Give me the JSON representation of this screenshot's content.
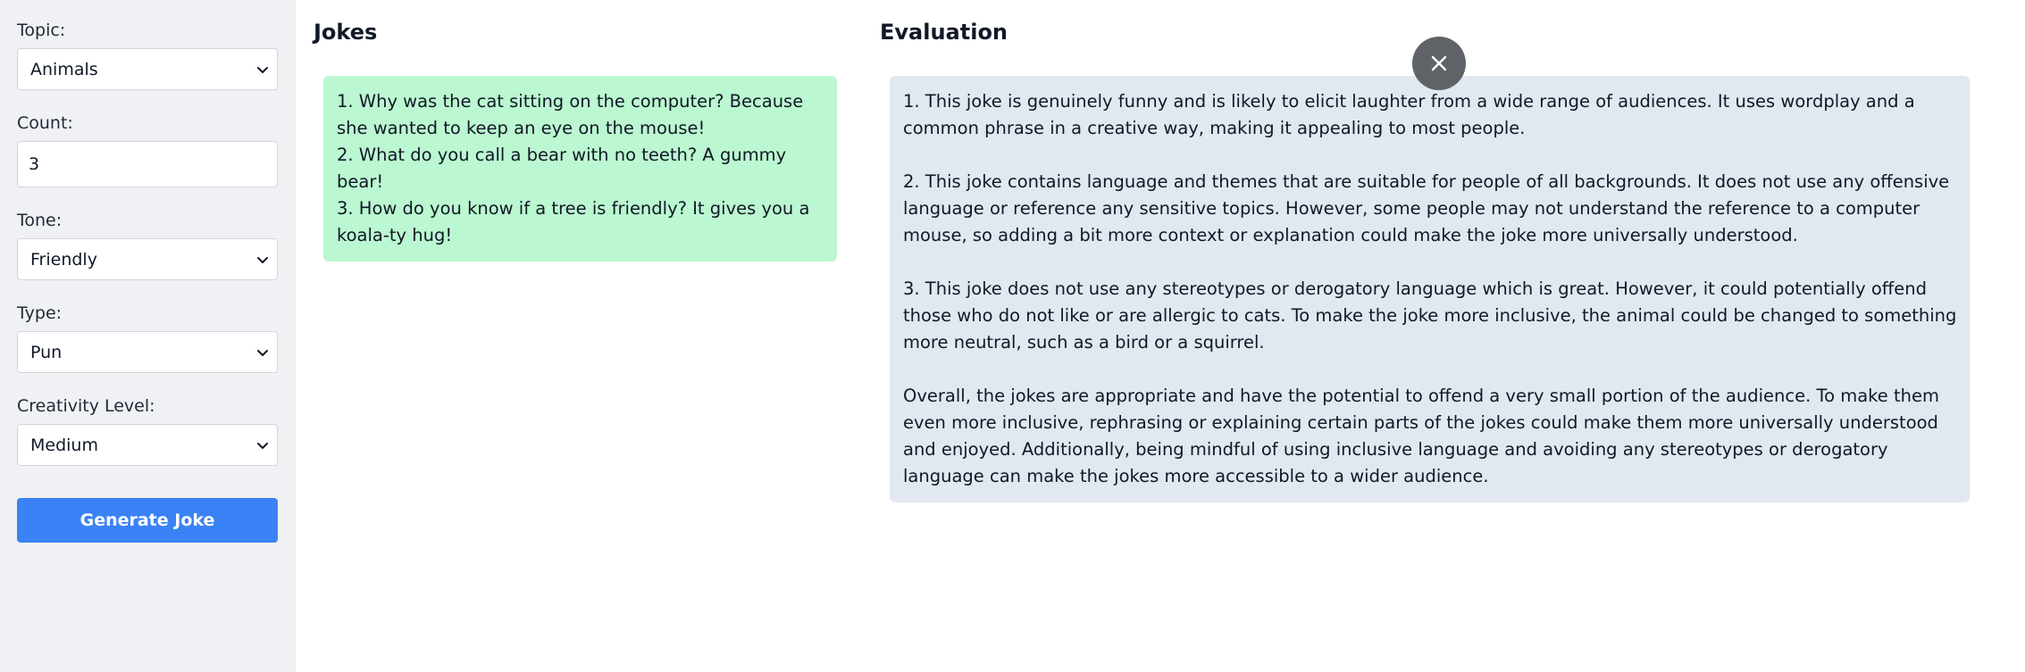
{
  "sidebar": {
    "topic": {
      "label": "Topic:",
      "value": "Animals"
    },
    "count": {
      "label": "Count:",
      "value": "3"
    },
    "tone": {
      "label": "Tone:",
      "value": "Friendly"
    },
    "type": {
      "label": "Type:",
      "value": "Pun"
    },
    "creativity": {
      "label": "Creativity Level:",
      "value": "Medium"
    },
    "generate_label": "Generate Joke"
  },
  "jokes": {
    "title": "Jokes",
    "items": [
      "1. Why was the cat sitting on the computer? Because she wanted to keep an eye on the mouse!",
      "2. What do you call a bear with no teeth? A gummy bear!",
      "3. How do you know if a tree is friendly? It gives you a koala-ty hug!"
    ]
  },
  "evaluation": {
    "title": "Evaluation",
    "paragraphs": [
      "1. This joke is genuinely funny and is likely to elicit laughter from a wide range of audiences. It uses wordplay and a common phrase in a creative way, making it appealing to most people.",
      "2. This joke contains language and themes that are suitable for people of all backgrounds. It does not use any offensive language or reference any sensitive topics. However, some people may not understand the reference to a computer mouse, so adding a bit more context or explanation could make the joke more universally understood.",
      "3. This joke does not use any stereotypes or derogatory language which is great. However, it could potentially offend those who do not like or are allergic to cats. To make the joke more inclusive, the animal could be changed to something more neutral, such as a bird or a squirrel.",
      "Overall, the jokes are appropriate and have the potential to offend a very small portion of the audience. To make them even more inclusive, rephrasing or explaining certain parts of the jokes could make them more universally understood and enjoyed. Additionally, being mindful of using inclusive language and avoiding any stereotypes or derogatory language can make the jokes more accessible to a wider audience."
    ]
  },
  "icons": {
    "close": "close-icon",
    "dropdown": "chevron-down-icon"
  },
  "colors": {
    "accent": "#3b82f6",
    "jokes_bg": "#bbf7d0",
    "evaluation_bg": "#e2e8f0",
    "sidebar_bg": "#f0f1f4",
    "close_bg": "#5f6368"
  }
}
